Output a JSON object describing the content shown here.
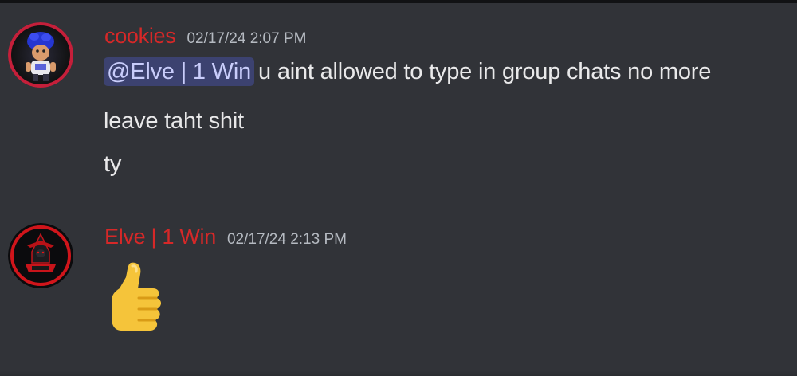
{
  "messages": [
    {
      "author": "cookies",
      "timestamp": "02/17/24 2:07 PM",
      "mention": "@Elve | 1 Win",
      "lines": [
        "u aint allowed to type in group chats no more",
        "leave taht shit",
        "ty"
      ],
      "avatar_icon": "avatar-cartoon-character-icon"
    },
    {
      "author": "Elve | 1 Win",
      "timestamp": "02/17/24 2:13 PM",
      "emoji": "thumbs-up-icon",
      "avatar_icon": "avatar-red-circle-logo-icon"
    }
  ],
  "colors": {
    "background": "#313338",
    "author_name": "#d62828",
    "timestamp": "#b5bac1",
    "message_text": "#e9e9ea",
    "mention_bg": "#3c4270",
    "mention_text": "#c9cdfb"
  }
}
